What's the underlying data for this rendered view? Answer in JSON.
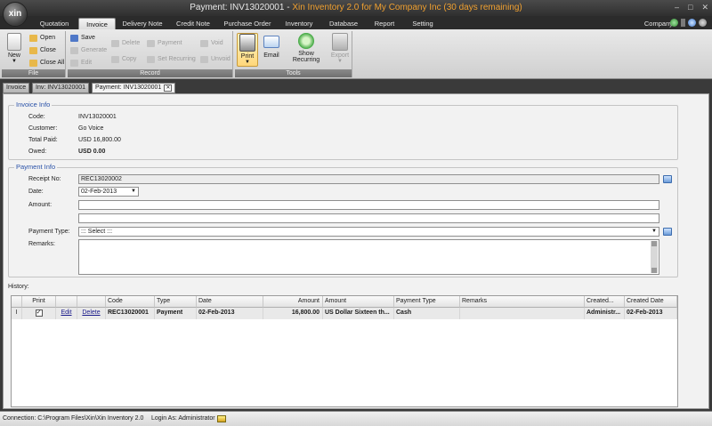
{
  "window": {
    "title_main": "Payment: INV13020001 - ",
    "title_accent": "Xin Inventory 2.0 for My Company Inc (30 days remaining)",
    "orb": "xin"
  },
  "menu": {
    "tabs": [
      "Quotation",
      "Invoice",
      "Delivery Note",
      "Credit Note",
      "Purchase Order",
      "Inventory",
      "Database",
      "Report",
      "Setting"
    ],
    "active": "Invoice",
    "company": "Company"
  },
  "ribbon": {
    "file": {
      "label": "File",
      "new": "New",
      "open": "Open",
      "close": "Close",
      "close_all": "Close All"
    },
    "record": {
      "label": "Record",
      "save": "Save",
      "generate": "Generate",
      "edit": "Edit",
      "delete": "Delete",
      "copy": "Copy",
      "payment": "Payment",
      "set_recurring": "Set Recurring",
      "void": "Void",
      "unvoid": "Unvoid"
    },
    "tools": {
      "label": "Tools",
      "print": "Print",
      "email": "Email",
      "show_recurring": "Show Recurring",
      "export": "Export"
    }
  },
  "doc_tabs": [
    "Invoice",
    "Inv: INV13020001",
    "Payment: INV13020001"
  ],
  "invoice_info": {
    "title": "Invoice Info",
    "code_label": "Code:",
    "code": "INV13020001",
    "customer_label": "Customer:",
    "customer": "Go Voice",
    "total_paid_label": "Total Paid:",
    "total_paid": "USD 16,800.00",
    "owed_label": "Owed:",
    "owed": "USD 0.00"
  },
  "payment_info": {
    "title": "Payment Info",
    "receipt_label": "Receipt No:",
    "receipt": "REC13020002",
    "date_label": "Date:",
    "date": "02-Feb-2013",
    "amount_label": "Amount:",
    "amount": "",
    "amount_words": "",
    "payment_type_label": "Payment Type:",
    "payment_type": "::: Select :::",
    "remarks_label": "Remarks:",
    "remarks": ""
  },
  "history": {
    "label": "History:",
    "columns": [
      "Print",
      "",
      "",
      "Code",
      "Type",
      "Date",
      "Amount",
      "Amount",
      "Payment Type",
      "Remarks",
      "Created...",
      "Created Date"
    ],
    "rows": [
      {
        "marker": "I",
        "print": "✓",
        "edit": "Edit",
        "delete": "Delete",
        "code": "REC13020001",
        "type": "Payment",
        "date": "02-Feb-2013",
        "amount": "16,800.00",
        "amount_words": "US Dollar Sixteen th...",
        "payment_type": "Cash",
        "remarks": "",
        "created_by": "Administr...",
        "created_date": "02-Feb-2013"
      }
    ]
  },
  "status": {
    "connection": "Connection: C:\\Program Files\\Xin\\Xin Inventory 2.0",
    "login": "Login As: Administrator"
  }
}
